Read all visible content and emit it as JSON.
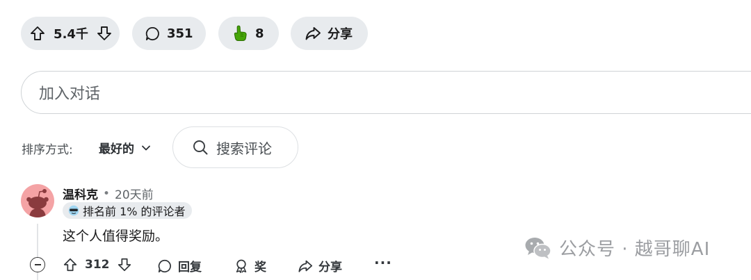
{
  "post_actions": {
    "vote_count": "5.4千",
    "comment_count": "351",
    "award_count": "8",
    "share_label": "分享"
  },
  "reply_box": {
    "placeholder": "加入对话"
  },
  "sort": {
    "label": "排序方式:",
    "value": "最好的"
  },
  "search": {
    "placeholder": "搜索评论"
  },
  "comment": {
    "author": "温科克",
    "separator": "•",
    "time": "20天前",
    "flair": "排名前 1% 的评论者",
    "body": "这个人值得奖励。",
    "vote_count": "312",
    "reply_label": "回复",
    "award_label": "奖",
    "share_label": "分享",
    "more_label": "···"
  },
  "watermark": {
    "text": "公众号 · 越哥聊AI"
  },
  "colors": {
    "pill_bg": "#e8ebee",
    "avatar_bg": "#f4a3a5",
    "award_green": "#46a508"
  }
}
